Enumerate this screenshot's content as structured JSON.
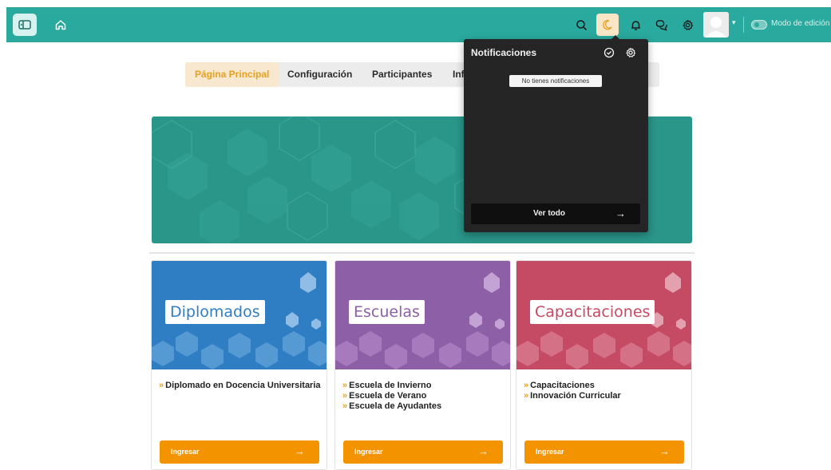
{
  "topbar": {
    "drawer_icon": "sidebar-toggle-icon",
    "home_icon": "home-icon",
    "search_icon": "search-icon",
    "dark_mode_icon": "moon-icon",
    "bell_icon": "bell-icon",
    "messages_icon": "chat-icon",
    "settings_icon": "gear-icon",
    "edit_mode_label": "Modo de edición",
    "brand_color": "#2aa99e"
  },
  "secondary_nav": {
    "tabs": [
      {
        "label": "Página Principal",
        "active": true
      },
      {
        "label": "Configuración",
        "active": false
      },
      {
        "label": "Participantes",
        "active": false
      },
      {
        "label": "Inf",
        "active": false
      }
    ]
  },
  "notifications": {
    "title": "Notificaciones",
    "mark_read_icon": "check-circle-icon",
    "settings_icon": "gear-icon",
    "empty_text": "No tienes notificaciones",
    "see_all_label": "Ver todo",
    "see_all_arrow": "→"
  },
  "cards": [
    {
      "title": "Diplomados",
      "color": "#2f7ec4",
      "items": [
        "Diplomado en Docencia Universitaria"
      ],
      "button_label": "Ingresar",
      "button_arrow": "→"
    },
    {
      "title": "Escuelas",
      "color": "#8d5fa6",
      "items": [
        "Escuela de Invierno",
        "Escuela de Verano",
        "Escuela de Ayudantes"
      ],
      "button_label": "Ingresar",
      "button_arrow": "→"
    },
    {
      "title": "Capacitaciones",
      "color": "#c54a63",
      "items": [
        "Capacitaciones",
        "Innovación Curricular"
      ],
      "button_label": "Ingresar",
      "button_arrow": "→"
    }
  ],
  "colors": {
    "accent": "#f39300",
    "hero": "#2a9589"
  }
}
